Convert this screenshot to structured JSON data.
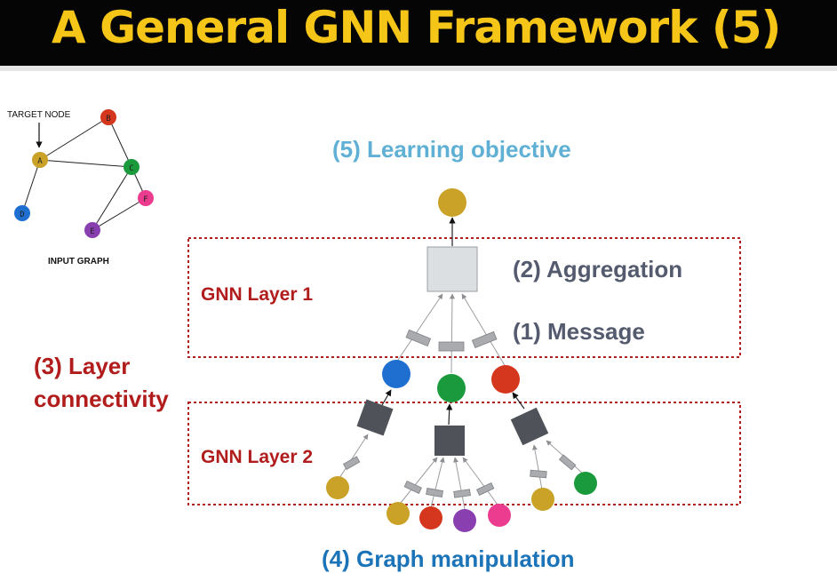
{
  "slide": {
    "title": "A General GNN Framework (5)"
  },
  "input_graph": {
    "target_label": "TARGET NODE",
    "caption": "INPUT GRAPH",
    "nodes": [
      {
        "id": "A",
        "color": "#c9a227"
      },
      {
        "id": "B",
        "color": "#d4361e"
      },
      {
        "id": "C",
        "color": "#1a9a3c"
      },
      {
        "id": "D",
        "color": "#1f6fd1"
      },
      {
        "id": "E",
        "color": "#8a3fb0"
      },
      {
        "id": "F",
        "color": "#ec3c8f"
      }
    ],
    "edges": [
      [
        "A",
        "B"
      ],
      [
        "A",
        "C"
      ],
      [
        "B",
        "C"
      ],
      [
        "A",
        "D"
      ],
      [
        "C",
        "E"
      ],
      [
        "C",
        "F"
      ],
      [
        "E",
        "F"
      ]
    ]
  },
  "annotations": {
    "learning_objective": "(5) Learning objective",
    "aggregation": "(2) Aggregation",
    "message": "(1) Message",
    "gnn_layer_1": "GNN Layer 1",
    "gnn_layer_2": "GNN Layer 2",
    "layer_connectivity_line1": "(3) Layer",
    "layer_connectivity_line2": "connectivity",
    "graph_manipulation": "(4) Graph manipulation"
  },
  "colors": {
    "title": "#f5c518",
    "layer_box": "#b11c1c",
    "node_gold": "#c9a227",
    "node_red": "#d4361e",
    "node_green": "#1a9a3c",
    "node_blue": "#1f6fd1",
    "node_purple": "#8a3fb0",
    "node_pink": "#ec3c8f",
    "aggregator_light": "#dcdfe2",
    "aggregator_dark": "#4f5359",
    "message_rect": "#a9abae"
  }
}
